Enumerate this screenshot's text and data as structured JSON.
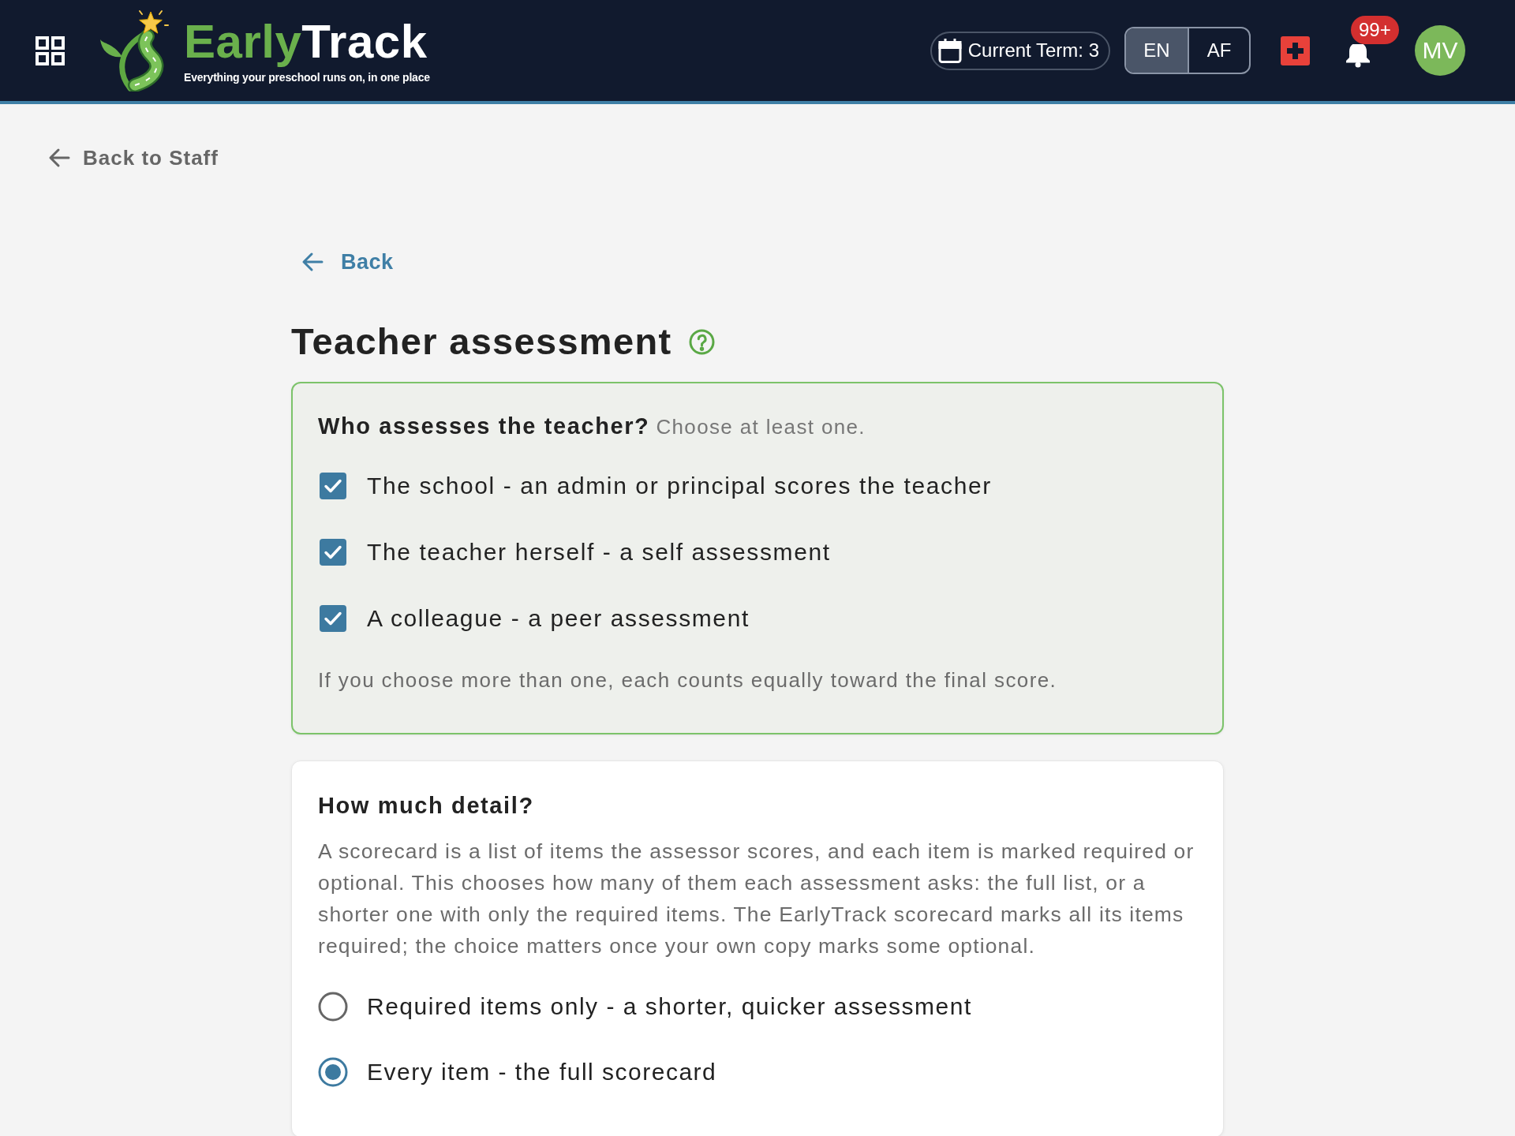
{
  "header": {
    "wordmark": {
      "part_1": "Early",
      "part_2": "Track"
    },
    "tagline": "Everything your preschool runs on, in one place",
    "term": "Current Term: 3",
    "languages": [
      {
        "label": "EN",
        "selected": true
      },
      {
        "label": "AF",
        "selected": false
      }
    ],
    "notification_count": "99+",
    "avatar_initials": "MV"
  },
  "back_to_staff": "Back to Staff",
  "back": "Back",
  "title": "Teacher assessment",
  "assessors": {
    "heading": "Who assesses the teacher?",
    "hint": "Choose at least one.",
    "options": [
      {
        "label": "The school - an admin or principal scores the teacher",
        "checked": true
      },
      {
        "label": "The teacher herself - a self assessment",
        "checked": true
      },
      {
        "label": "A colleague - a peer assessment",
        "checked": true
      }
    ],
    "note": "If you choose more than one, each counts equally toward the final score."
  },
  "detail": {
    "heading": "How much detail?",
    "description": "A scorecard is a list of items the assessor scores, and each item is marked required or optional. This chooses how many of them each assessment asks: the full list, or a shorter one with only the required items. The EarlyTrack scorecard marks all its items required; the choice matters once your own copy marks some optional.",
    "options": [
      {
        "label": "Required items only - a shorter, quicker assessment",
        "selected": false
      },
      {
        "label": "Every item - the full scorecard",
        "selected": true
      }
    ]
  }
}
